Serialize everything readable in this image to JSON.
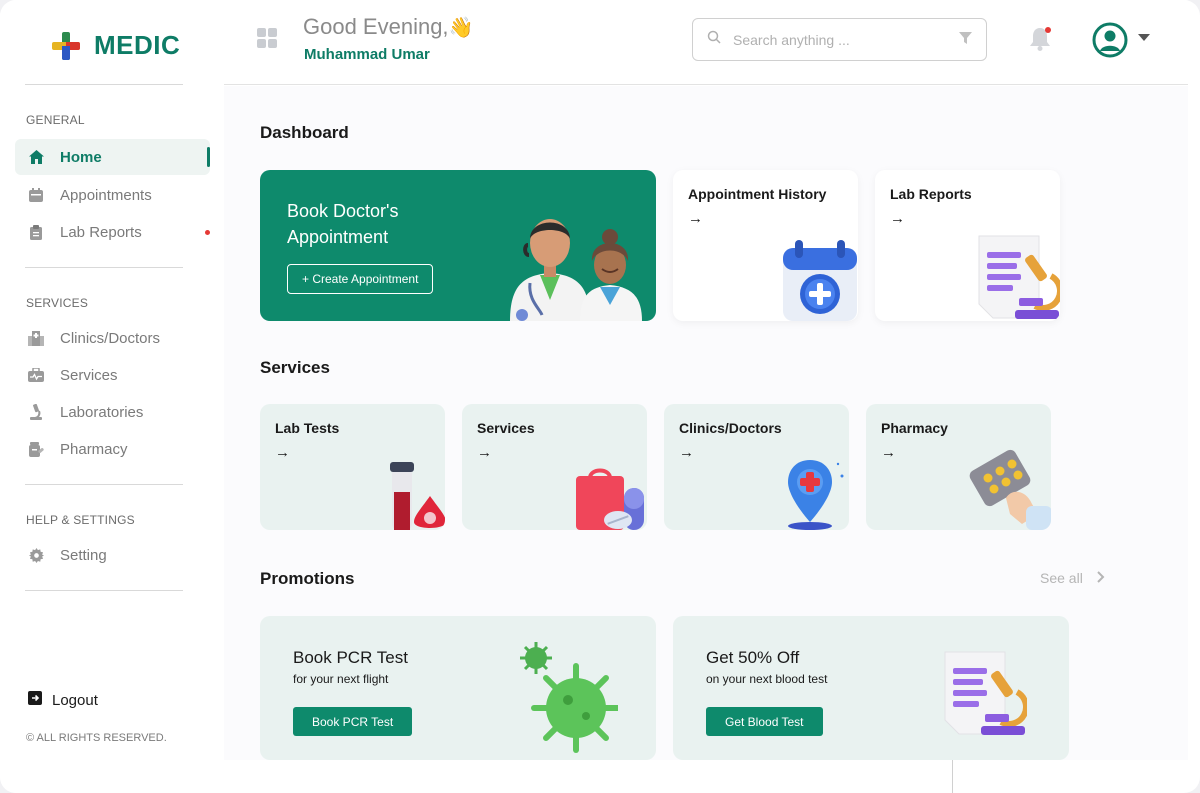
{
  "app": {
    "name": "MEDIC"
  },
  "sidebar": {
    "sections": [
      {
        "label": "GENERAL"
      },
      {
        "label": "SERVICES"
      },
      {
        "label": "HELP & SETTINGS"
      }
    ],
    "items": [
      {
        "label": "Home",
        "icon": "home-icon"
      },
      {
        "label": "Appointments",
        "icon": "calendar-icon"
      },
      {
        "label": "Lab Reports",
        "icon": "clipboard-icon"
      },
      {
        "label": "Clinics/Doctors",
        "icon": "hospital-icon"
      },
      {
        "label": "Services",
        "icon": "medical-bag-icon"
      },
      {
        "label": "Laboratories",
        "icon": "microscope-icon"
      },
      {
        "label": "Pharmacy",
        "icon": "pill-bottle-icon"
      },
      {
        "label": "Setting",
        "icon": "gear-icon"
      }
    ],
    "logout": "Logout",
    "copyright": "© ALL RIGHTS RESERVED."
  },
  "header": {
    "greeting": "Good Evening,",
    "greeting_emoji": "👋",
    "user_name": "Muhammad Umar",
    "search_placeholder": "Search anything ..."
  },
  "dashboard": {
    "title": "Dashboard",
    "hero": {
      "title": "Book Doctor's Appointment",
      "button": "+ Create Appointment"
    },
    "cards": [
      {
        "title": "Appointment History",
        "arrow": "→"
      },
      {
        "title": "Lab Reports",
        "arrow": "→"
      }
    ]
  },
  "services": {
    "title": "Services",
    "cards": [
      {
        "title": "Lab Tests",
        "arrow": "→"
      },
      {
        "title": "Services",
        "arrow": "→"
      },
      {
        "title": "Clinics/Doctors",
        "arrow": "→"
      },
      {
        "title": "Pharmacy",
        "arrow": "→"
      }
    ]
  },
  "promotions": {
    "title": "Promotions",
    "see_all": "See all",
    "cards": [
      {
        "title": "Book PCR Test",
        "subtitle": "for your next flight",
        "button": "Book PCR Test"
      },
      {
        "title": "Get 50% Off",
        "subtitle": "on your next blood test",
        "button": "Get Blood Test"
      }
    ]
  },
  "colors": {
    "brand": "#0e7c66",
    "hero_bg": "#0e8a6c",
    "card_bg": "#e9f2f0",
    "alert": "#e53935"
  }
}
